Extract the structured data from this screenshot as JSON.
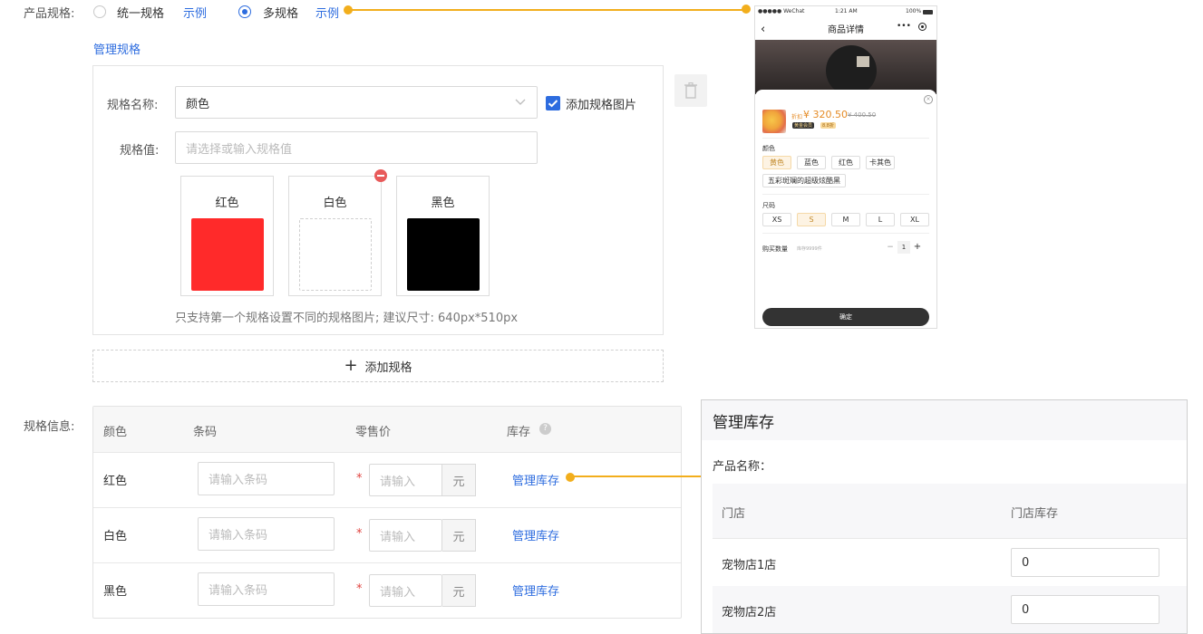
{
  "spec_type": {
    "label": "产品规格:",
    "option_single": "统一规格",
    "option_single_example": "示例",
    "option_multi": "多规格",
    "option_multi_example": "示例",
    "selected": "多规格"
  },
  "manage_spec_link": "管理规格",
  "spec_editor": {
    "name_label": "规格名称:",
    "name_value": "颜色",
    "add_image_checkbox": "添加规格图片",
    "add_image_checked": true,
    "value_label": "规格值:",
    "value_placeholder": "请选择或输入规格值",
    "values": [
      {
        "name": "红色",
        "color": "#ff2a2a"
      },
      {
        "name": "白色",
        "color": "#ffffff"
      },
      {
        "name": "黑色",
        "color": "#000000"
      }
    ],
    "hint": "只支持第一个规格设置不同的规格图片; 建议尺寸: 640px*510px"
  },
  "add_spec_button": "添加规格",
  "spec_info": {
    "label": "规格信息:",
    "headers": {
      "color": "颜色",
      "barcode": "条码",
      "price": "零售价",
      "stock": "库存"
    },
    "rows": [
      {
        "color": "红色",
        "barcode_placeholder": "请输入条码",
        "price_placeholder": "请输入",
        "unit": "元",
        "stock_link": "管理库存"
      },
      {
        "color": "白色",
        "barcode_placeholder": "请输入条码",
        "price_placeholder": "请输入",
        "unit": "元",
        "stock_link": "管理库存"
      },
      {
        "color": "黑色",
        "barcode_placeholder": "请输入条码",
        "price_placeholder": "请输入",
        "unit": "元",
        "stock_link": "管理库存"
      }
    ]
  },
  "phone_preview": {
    "status_left": "●●●●● WeChat",
    "status_time": "1:21 AM",
    "status_battery": "100%",
    "title": "商品详情",
    "more": "•••",
    "tag": "折扣",
    "price": "¥ 320.50",
    "old_price": "¥ 400.50",
    "badge_member": "黄金会员",
    "badge_discount": "8.8折",
    "color_label": "颜色",
    "colors": [
      "黄色",
      "蓝色",
      "红色",
      "卡其色"
    ],
    "color_extra": "五彩斑斓的超级炫酷黑",
    "size_label": "尺码",
    "sizes": [
      "XS",
      "S",
      "M",
      "L",
      "XL"
    ],
    "qty_label": "购买数量",
    "stock_text": "库存9999件",
    "qty": "1",
    "confirm": "确定",
    "accent": "#f2ae1c"
  },
  "stock_panel": {
    "title": "管理库存",
    "product_name_label": "产品名称：",
    "col_store": "门店",
    "col_stock": "门店库存",
    "rows": [
      {
        "store": "宠物店1店",
        "stock": "0"
      },
      {
        "store": "宠物店2店",
        "stock": "0"
      }
    ]
  }
}
